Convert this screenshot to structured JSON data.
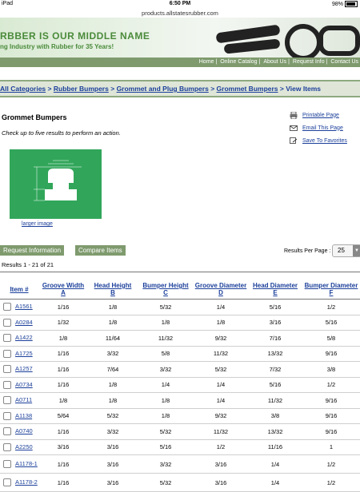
{
  "status_bar": {
    "device": "iPad",
    "time": "6:50 PM",
    "battery": "98%"
  },
  "browser": {
    "url": "products.allstatesrubber.com"
  },
  "banner": {
    "tagline1": "RBBER IS OUR MIDDLE NAME",
    "tagline2": "ng Industry with Rubber for 35 Years!"
  },
  "top_nav": [
    "Home",
    "Online Catalog",
    "About Us",
    "Request Info",
    "Contact Us"
  ],
  "breadcrumb": [
    "All Categories",
    "Rubber Bumpers",
    "Grommet and Plug Bumpers",
    "Grommet Bumpers",
    "View Items"
  ],
  "page_title": "Grommet Bumpers",
  "instruction": "Check up to five results to perform an action.",
  "actions": {
    "print": "Printable Page",
    "email": "Email This Page",
    "favorites": "Save To Favorites"
  },
  "larger_image": "larger image",
  "tabs": {
    "request": "Request Information",
    "compare": "Compare Items"
  },
  "results_per_page": {
    "label": "Results Per Page :",
    "value": "25"
  },
  "results_count": "Results 1 - 21 of 21",
  "table": {
    "headers": [
      [
        "Item #"
      ],
      [
        "Groove Width",
        "A"
      ],
      [
        "Head Height",
        "B"
      ],
      [
        "Bumper Height",
        "C"
      ],
      [
        "Groove Diameter",
        "D"
      ],
      [
        "Head Diameter",
        "E"
      ],
      [
        "Bumper Diameter",
        "F"
      ]
    ],
    "rows": [
      [
        "A1561",
        "1/16",
        "1/8",
        "5/32",
        "1/4",
        "5/16",
        "1/2"
      ],
      [
        "A0284",
        "1/32",
        "1/8",
        "1/8",
        "1/8",
        "3/16",
        "5/16"
      ],
      [
        "A1422",
        "1/8",
        "11/64",
        "11/32",
        "9/32",
        "7/16",
        "5/8"
      ],
      [
        "A1725",
        "1/16",
        "3/32",
        "5/8",
        "11/32",
        "13/32",
        "9/16"
      ],
      [
        "A1257",
        "1/16",
        "7/64",
        "3/32",
        "5/32",
        "7/32",
        "3/8"
      ],
      [
        "A0734",
        "1/16",
        "1/8",
        "1/4",
        "1/4",
        "5/16",
        "1/2"
      ],
      [
        "A0711",
        "1/8",
        "1/8",
        "1/8",
        "1/4",
        "11/32",
        "9/16"
      ],
      [
        "A1138",
        "5/64",
        "5/32",
        "1/8",
        "9/32",
        "3/8",
        "9/16"
      ],
      [
        "A0740",
        "1/16",
        "3/32",
        "5/32",
        "11/32",
        "13/32",
        "9/16"
      ],
      [
        "A2250",
        "3/16",
        "3/16",
        "5/16",
        "1/2",
        "11/16",
        "1"
      ],
      [
        "A1178-1",
        "1/16",
        "3/16",
        "3/32",
        "3/16",
        "1/4",
        "1/2"
      ],
      [
        "A1178-2",
        "1/16",
        "3/16",
        "5/32",
        "3/16",
        "1/4",
        "1/2"
      ]
    ]
  }
}
